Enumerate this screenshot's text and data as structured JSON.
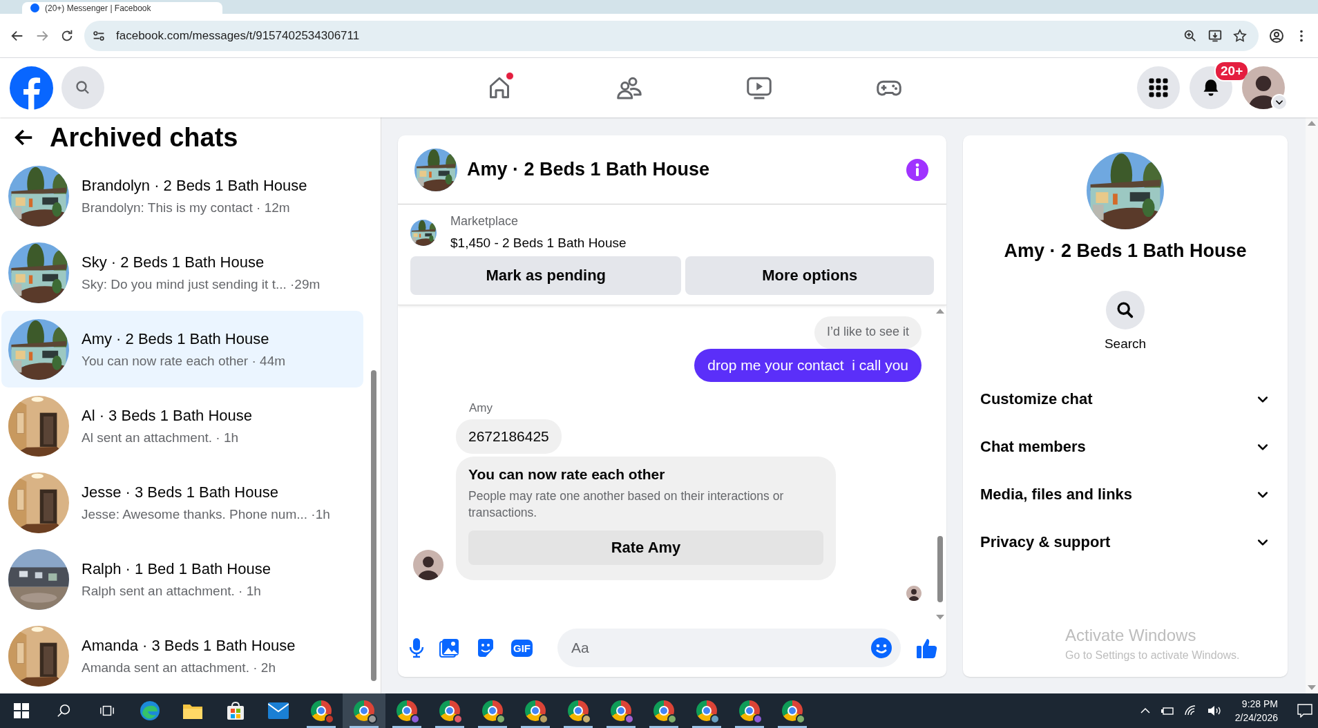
{
  "browser": {
    "tab_title": "(20+) Messenger | Facebook",
    "url": "facebook.com/messages/t/9157402534306711"
  },
  "nav": {
    "items": [
      {
        "kind": "home",
        "dot": true
      },
      {
        "kind": "friends",
        "dot": false
      },
      {
        "kind": "video",
        "dot": false
      },
      {
        "kind": "gaming",
        "dot": false
      }
    ],
    "notifications": "20+"
  },
  "sidebar": {
    "title": "Archived chats",
    "chats": [
      {
        "name": "Brandolyn · 2 Beds 1 Bath House",
        "snippet": "Brandolyn: This is my contact · 12m",
        "selected": false
      },
      {
        "name": "Sky · 2 Beds 1 Bath House",
        "snippet": "Sky: Do you mind just sending it t... ·29m",
        "selected": false
      },
      {
        "name": "Amy · 2 Beds 1 Bath House",
        "snippet": "You can now rate each other · 44m",
        "selected": true
      },
      {
        "name": "Al · 3 Beds 1 Bath House",
        "snippet": "Al sent an attachment. · 1h",
        "selected": false
      },
      {
        "name": "Jesse · 3 Beds 1 Bath House",
        "snippet": "Jesse: Awesome thanks. Phone num... ·1h",
        "selected": false
      },
      {
        "name": "Ralph · 1 Bed 1 Bath House",
        "snippet": "Ralph sent an attachment. · 1h",
        "selected": false
      },
      {
        "name": "Amanda · 3 Beds 1 Bath House",
        "snippet": "Amanda sent an attachment. · 2h",
        "selected": false
      }
    ]
  },
  "conversation": {
    "title": "Amy · 2 Beds 1 Bath House",
    "listing": {
      "label": "Marketplace",
      "title": "$1,450 - 2 Beds 1 Bath House"
    },
    "actions": [
      "Mark as pending",
      "More options"
    ],
    "messages": [
      {
        "kind": "reply",
        "text": "I’d like to see it"
      },
      {
        "kind": "outgoing",
        "text": "drop me your contact  i call you"
      },
      {
        "kind": "sender",
        "text": "Amy"
      },
      {
        "kind": "incoming",
        "text": "2672186425"
      },
      {
        "kind": "card",
        "title": "You can now rate each other",
        "body": "People may rate one another based on their interactions or transactions.",
        "button": "Rate Amy"
      }
    ],
    "composer": {
      "gif_label": "GIF",
      "placeholder": "Aa"
    }
  },
  "info": {
    "title": "Amy · 2 Beds 1 Bath House",
    "search_label": "Search",
    "sections": [
      {
        "label": "Customize chat",
        "expanded": false
      },
      {
        "label": "Chat members",
        "expanded": false
      },
      {
        "label": "Media, files and links",
        "expanded": false
      },
      {
        "label": "Privacy & support",
        "expanded": false
      }
    ]
  },
  "activation": {
    "title": "Activate Windows",
    "text": "Go to Settings to activate Windows."
  },
  "taskbar": {
    "time": "9:28 PM",
    "date": "2/24/2026"
  }
}
